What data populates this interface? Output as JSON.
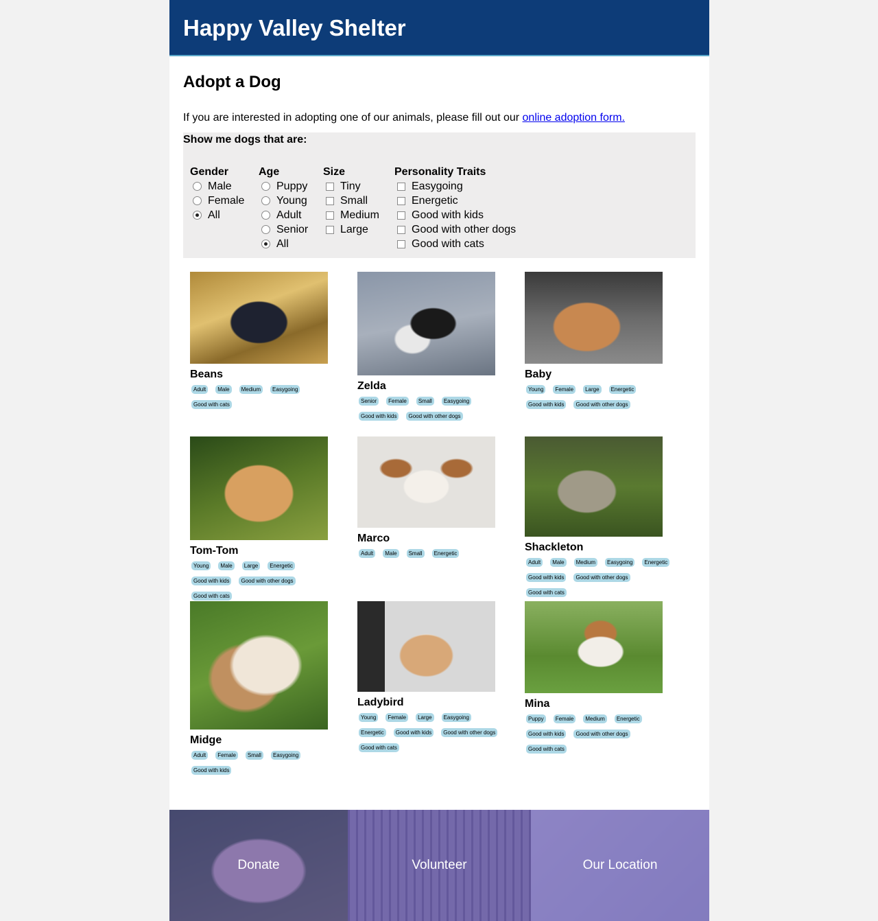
{
  "site": {
    "title": "Happy Valley Shelter"
  },
  "main": {
    "heading": "Adopt a Dog",
    "intro_text": "If you are interested in adopting one of our animals, please fill out our ",
    "intro_link": "online adoption form."
  },
  "filters": {
    "title": "Show me dogs that are:",
    "gender": {
      "label": "Gender",
      "options": [
        "Male",
        "Female",
        "All"
      ],
      "selected": "All"
    },
    "age": {
      "label": "Age",
      "options": [
        "Puppy",
        "Young",
        "Adult",
        "Senior",
        "All"
      ],
      "selected": "All"
    },
    "size": {
      "label": "Size",
      "options": [
        "Tiny",
        "Small",
        "Medium",
        "Large"
      ]
    },
    "traits": {
      "label": "Personality Traits",
      "options": [
        "Easygoing",
        "Energetic",
        "Good with kids",
        "Good with other dogs",
        "Good with cats"
      ]
    }
  },
  "dogs": [
    {
      "name": "Beans",
      "tags": [
        "Adult",
        "Male",
        "Medium",
        "Easygoing",
        "Good with cats"
      ]
    },
    {
      "name": "Zelda",
      "tags": [
        "Senior",
        "Female",
        "Small",
        "Easygoing",
        "Good with kids",
        "Good with other dogs"
      ]
    },
    {
      "name": "Baby",
      "tags": [
        "Young",
        "Female",
        "Large",
        "Energetic",
        "Good with kids",
        "Good with other dogs"
      ]
    },
    {
      "name": "Tom-Tom",
      "tags": [
        "Young",
        "Male",
        "Large",
        "Energetic",
        "Good with kids",
        "Good with other dogs",
        "Good with cats"
      ]
    },
    {
      "name": "Marco",
      "tags": [
        "Adult",
        "Male",
        "Small",
        "Energetic"
      ]
    },
    {
      "name": "Shackleton",
      "tags": [
        "Adult",
        "Male",
        "Medium",
        "Easygoing",
        "Energetic",
        "Good with kids",
        "Good with other dogs",
        "Good with cats"
      ]
    },
    {
      "name": "Midge",
      "tags": [
        "Adult",
        "Female",
        "Small",
        "Easygoing",
        "Good with kids"
      ]
    },
    {
      "name": "Ladybird",
      "tags": [
        "Young",
        "Female",
        "Large",
        "Easygoing",
        "Energetic",
        "Good with kids",
        "Good with other dogs",
        "Good with cats"
      ]
    },
    {
      "name": "Mina",
      "tags": [
        "Puppy",
        "Female",
        "Medium",
        "Energetic",
        "Good with kids",
        "Good with other dogs",
        "Good with cats"
      ]
    }
  ],
  "footer": {
    "donate": "Donate",
    "volunteer": "Volunteer",
    "location": "Our Location"
  },
  "colors": {
    "header_bg": "#0d3c78",
    "tag_bg": "#add8e6",
    "filter_bg": "#eeeded",
    "footer_overlay": "#503caa"
  }
}
